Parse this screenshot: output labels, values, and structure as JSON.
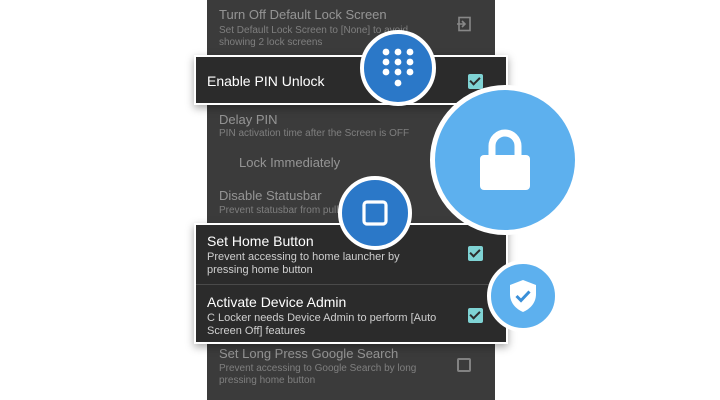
{
  "settings": {
    "turn_off_lock": {
      "title": "Turn Off Default Lock Screen",
      "subtitle": "Set Default Lock Screen to [None] to avoid showing 2 lock screens"
    },
    "enable_pin": {
      "title": "Enable PIN Unlock",
      "checked": true
    },
    "delay_pin": {
      "title": "Delay PIN",
      "subtitle": "PIN activation time after the Screen is OFF",
      "selected_option": "Lock Immediately"
    },
    "disable_statusbar": {
      "title": "Disable Statusbar",
      "subtitle": "Prevent statusbar from pulling down",
      "checked": true
    },
    "set_home": {
      "title": "Set Home Button",
      "subtitle": "Prevent accessing to home launcher by pressing home button",
      "checked": true
    },
    "device_admin": {
      "title": "Activate Device Admin",
      "subtitle": "C Locker needs Device Admin to perform [Auto Screen Off] features",
      "checked": true
    },
    "long_press_search": {
      "title": "Set Long Press Google Search",
      "subtitle": "Prevent accessing to Google Search by long pressing home button",
      "checked": false
    }
  },
  "icons": {
    "keypad": "keypad-icon",
    "lock": "lock-icon",
    "home_square": "square-icon",
    "shield": "shield-check-icon",
    "exit": "exit-icon"
  },
  "colors": {
    "panel": "#3b3b3b",
    "popout": "#2b2b2b",
    "checkbox": "#7fd3d4",
    "badge_blue": "#2b78c8",
    "lock_blue": "#5db0ee"
  }
}
